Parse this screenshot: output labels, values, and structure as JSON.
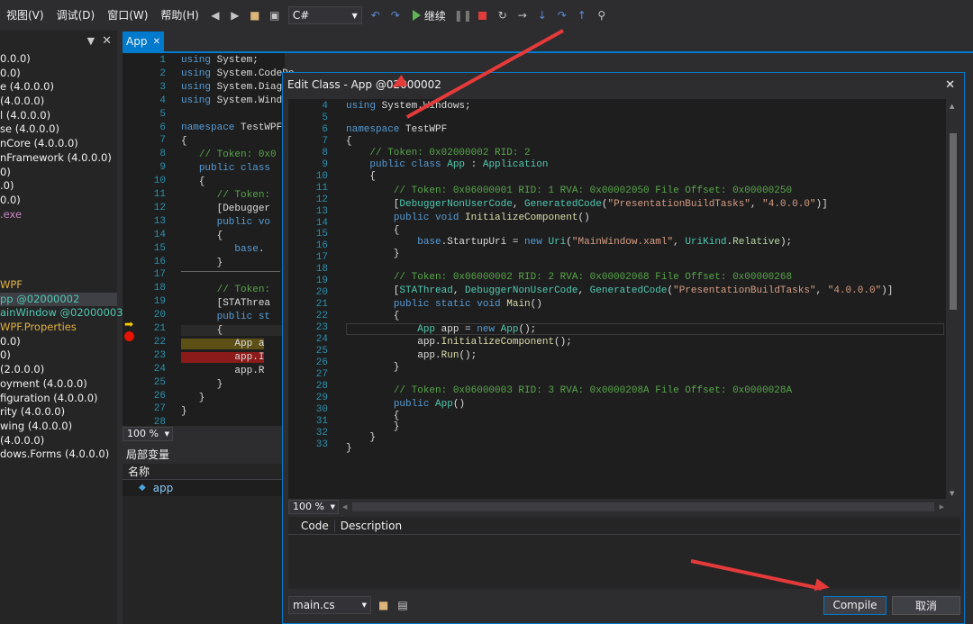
{
  "menu": [
    "视图(V)",
    "调试(D)",
    "窗口(W)",
    "帮助(H)"
  ],
  "toolbar": {
    "language": "C#",
    "continue_label": "继续"
  },
  "left_tree": [
    "0.0.0)",
    "0.0)",
    "e (4.0.0.0)",
    "(4.0.0.0)",
    "l (4.0.0.0)",
    "se (4.0.0.0)",
    "nCore (4.0.0.0)",
    "nFramework (4.0.0.0)",
    "0)",
    ".0)",
    "0.0)",
    ".exe",
    "",
    "",
    "",
    "",
    "WPF",
    "pp @02000002",
    "ainWindow @02000003",
    "WPF.Properties",
    "0.0)",
    "0)",
    "(2.0.0.0)",
    "oyment (4.0.0.0)",
    "figuration (4.0.0.0)",
    "rity (4.0.0.0)",
    "wing (4.0.0.0)",
    " (4.0.0.0)",
    "dows.Forms (4.0.0.0)"
  ],
  "editor": {
    "tab_label": "App",
    "zoom": "100 %",
    "line_numbers": [
      "1",
      "2",
      "3",
      "4",
      "5",
      "6",
      "7",
      "8",
      "9",
      "10",
      "11",
      "12",
      "13",
      "14",
      "15",
      "16",
      "17",
      "18",
      "19",
      "20",
      "21",
      "22",
      "23",
      "24",
      "25",
      "26",
      "27",
      "28"
    ]
  },
  "locals": {
    "title": "局部变量",
    "column_name": "名称",
    "row_value": "app"
  },
  "dialog": {
    "title": "Edit Class - App @02000002",
    "zoom": "100 %",
    "error_columns": [
      "Code",
      "Description"
    ],
    "file": "main.cs",
    "compile_label": "Compile",
    "cancel_label": "取消",
    "line_numbers": [
      "4",
      "5",
      "6",
      "7",
      "8",
      "9",
      "10",
      "11",
      "12",
      "13",
      "14",
      "15",
      "16",
      "17",
      "18",
      "19",
      "20",
      "21",
      "22",
      "23",
      "24",
      "25",
      "26",
      "27",
      "28",
      "29",
      "30",
      "31",
      "32",
      "33"
    ]
  },
  "colors": {
    "accent": "#007acc",
    "arrow": "#e53a3a",
    "keyword": "#569cd6",
    "type": "#4ec9b0",
    "comment": "#57a64a",
    "string": "#d69d85"
  }
}
